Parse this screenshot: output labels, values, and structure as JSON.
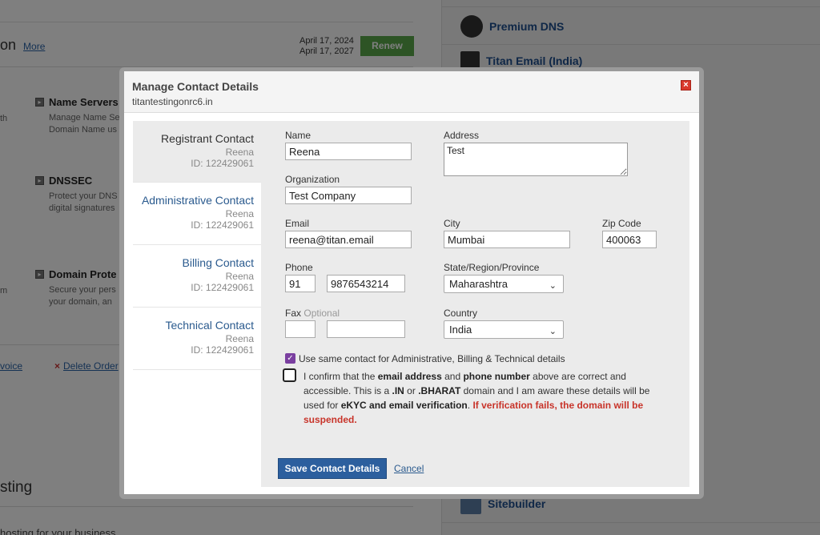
{
  "background": {
    "title_fragment": "on",
    "more_link": "More",
    "date1": "April 17, 2024",
    "date2": "April 17, 2027",
    "renew_label": "Renew",
    "features": [
      {
        "title": "Name Servers",
        "desc1": "Manage Name Se",
        "desc2": "Domain Name us"
      },
      {
        "title": "DNSSEC",
        "desc1": "Protect your DNS",
        "desc2": "digital signatures"
      },
      {
        "title": "Domain Prote",
        "desc1": "Secure your pers",
        "desc2": "your domain, an"
      }
    ],
    "left_fragments": [
      "th",
      "m"
    ],
    "invoice_link": "voice",
    "delete_order_link": "Delete Order",
    "hosting_title": "sting",
    "hosting_sub": "hosting for your business",
    "sidebar": {
      "items": [
        "Premium DNS",
        "Titan Email (India)",
        "Sitebuilder"
      ]
    }
  },
  "modal": {
    "title": "Manage Contact Details",
    "domain": "titantestingonrc6.in",
    "close_label": "×",
    "tabs": [
      {
        "label": "Registrant Contact",
        "name": "Reena",
        "id": "ID: 122429061",
        "active": true
      },
      {
        "label": "Administrative Contact",
        "name": "Reena",
        "id": "ID: 122429061",
        "active": false
      },
      {
        "label": "Billing Contact",
        "name": "Reena",
        "id": "ID: 122429061",
        "active": false
      },
      {
        "label": "Technical Contact",
        "name": "Reena",
        "id": "ID: 122429061",
        "active": false
      }
    ],
    "form": {
      "name_label": "Name",
      "name_value": "Reena",
      "address_label": "Address",
      "address_value": "Test",
      "org_label": "Organization",
      "org_value": "Test Company",
      "email_label": "Email",
      "email_value": "reena@titan.email",
      "city_label": "City",
      "city_value": "Mumbai",
      "zip_label": "Zip Code",
      "zip_value": "400063",
      "phone_label": "Phone",
      "phone_cc": "91",
      "phone_value": "9876543214",
      "state_label": "State/Region/Province",
      "state_value": "Maharashtra",
      "fax_label": "Fax",
      "fax_optional": "Optional",
      "fax_cc": "",
      "fax_value": "",
      "country_label": "Country",
      "country_value": "India",
      "same_contact_label": "Use same contact for Administrative, Billing & Technical details",
      "confirm": {
        "p1": "I confirm that the ",
        "b1": "email address",
        "p2": " and ",
        "b2": "phone number",
        "p3": " above are correct and accessible. This is a ",
        "b3": ".IN",
        "p4": " or ",
        "b4": ".BHARAT",
        "p5": " domain and I am aware these details will be used for ",
        "b5": "eKYC and email verification",
        "p6": ". ",
        "warn": "If verification fails, the domain will be suspended."
      },
      "save_label": "Save Contact Details",
      "cancel_label": "Cancel"
    }
  }
}
